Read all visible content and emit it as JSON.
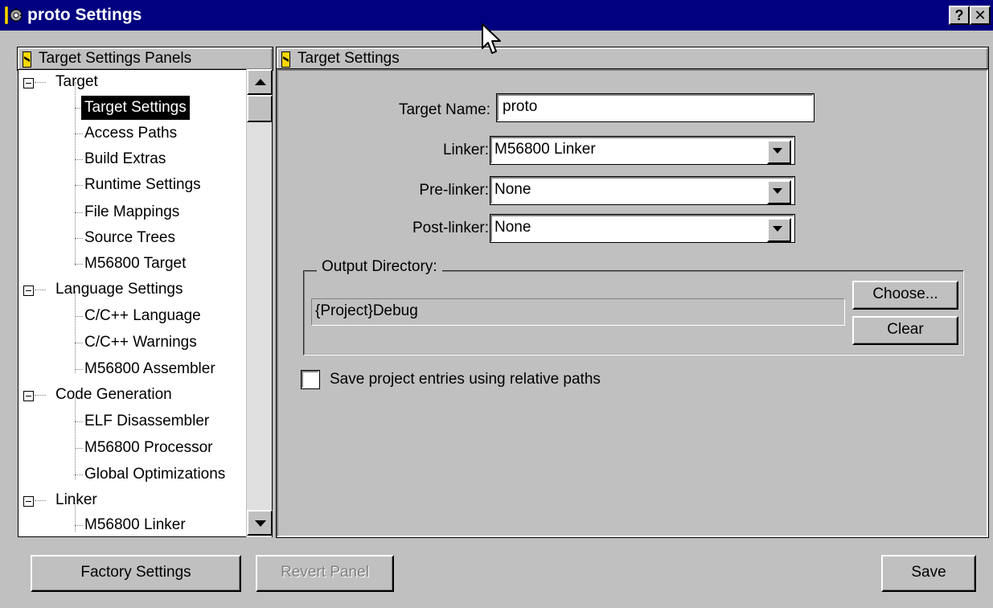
{
  "window": {
    "title": "proto Settings",
    "help_label": "?",
    "close_label": "✕"
  },
  "tree": {
    "header": "Target Settings Panels",
    "groups": [
      {
        "label": "Target",
        "children": [
          "Target Settings",
          "Access Paths",
          "Build Extras",
          "Runtime Settings",
          "File Mappings",
          "Source Trees",
          "M56800 Target"
        ]
      },
      {
        "label": "Language Settings",
        "children": [
          "C/C++ Language",
          "C/C++ Warnings",
          "M56800 Assembler"
        ]
      },
      {
        "label": "Code Generation",
        "children": [
          "ELF Disassembler",
          "M56800 Processor",
          "Global Optimizations"
        ]
      },
      {
        "label": "Linker",
        "children": [
          "M56800 Linker"
        ]
      }
    ],
    "selected": "Target Settings"
  },
  "panel": {
    "header": "Target Settings",
    "target_name_label": "Target Name:",
    "target_name_value": "proto",
    "linker_label": "Linker:",
    "linker_value": "M56800 Linker",
    "prelinker_label": "Pre-linker:",
    "prelinker_value": "None",
    "postlinker_label": "Post-linker:",
    "postlinker_value": "None",
    "output_dir_label": "Output Directory:",
    "output_dir_value": "{Project}Debug",
    "choose_label": "Choose...",
    "clear_label": "Clear",
    "relative_paths_label": "Save project entries using relative paths",
    "relative_paths_checked": false
  },
  "footer": {
    "factory_label": "Factory Settings",
    "revert_label": "Revert Panel",
    "save_label": "Save"
  },
  "colors": {
    "titlebar": "#000080",
    "face": "#c0c0c0",
    "selection": "#000000"
  }
}
